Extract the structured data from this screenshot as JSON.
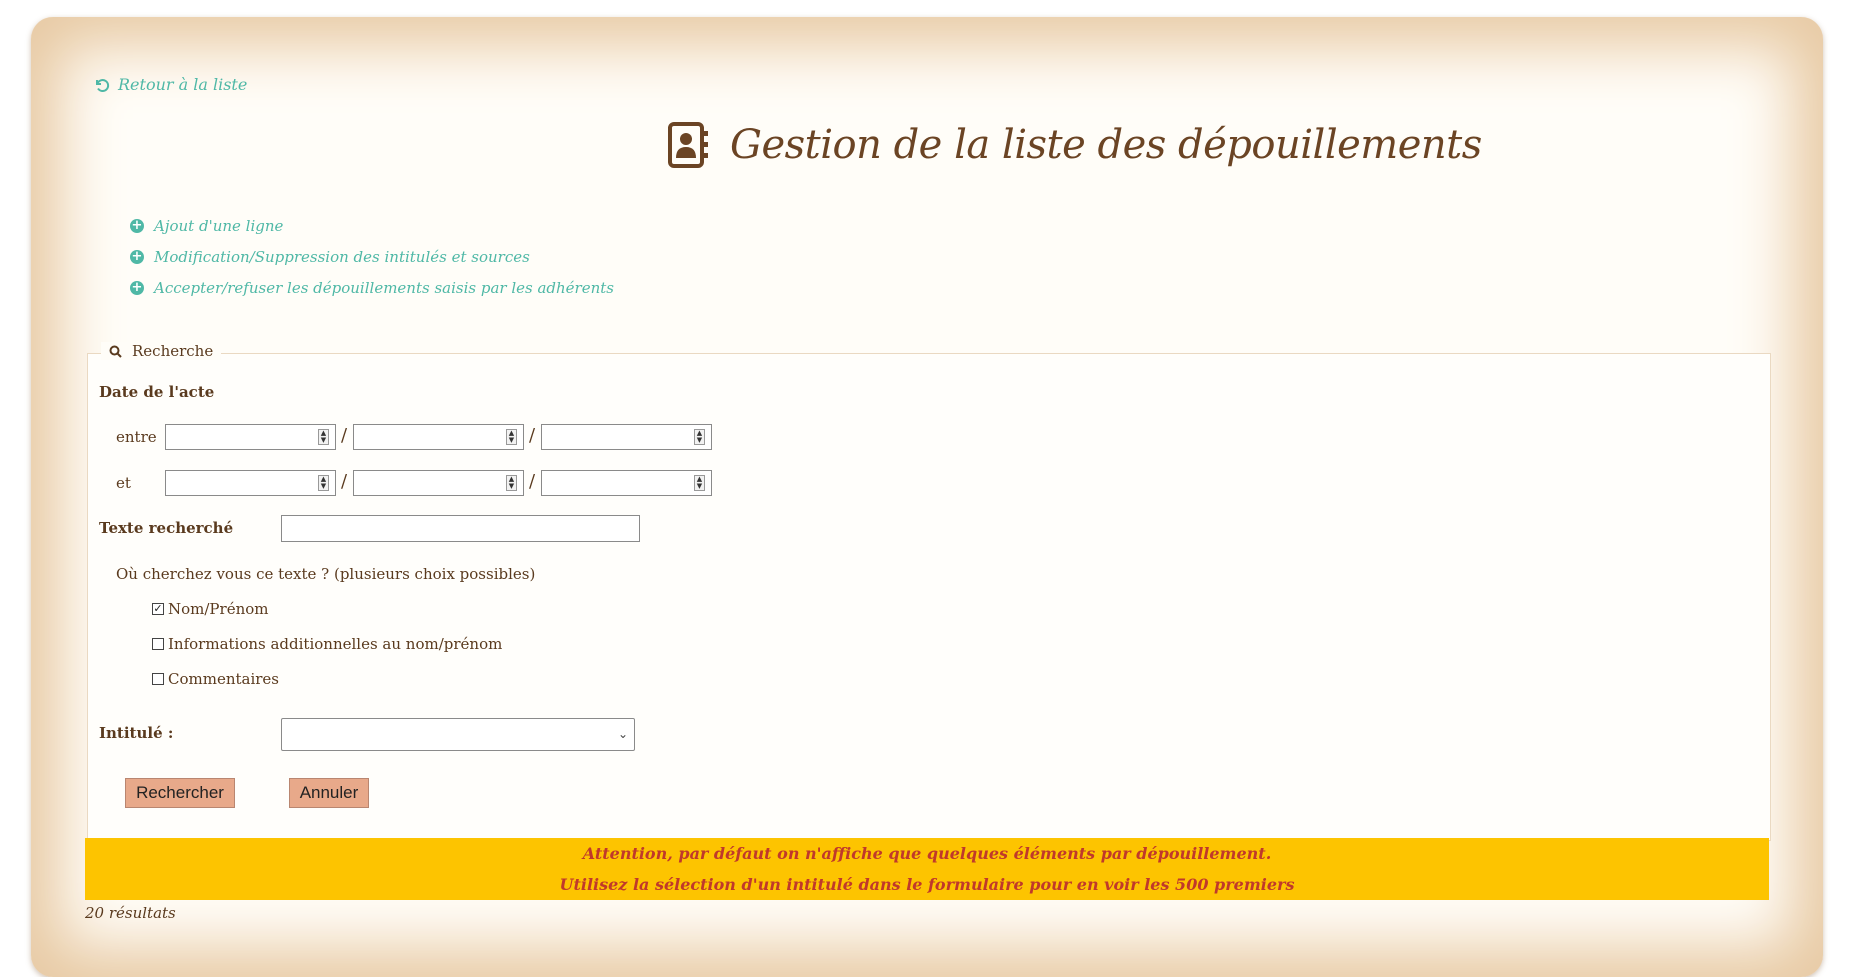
{
  "nav": {
    "back_label": "Retour à la liste"
  },
  "page": {
    "title": "Gestion de la liste des dépouillements"
  },
  "actions": [
    {
      "label": "Ajout d'une ligne"
    },
    {
      "label": "Modification/Suppression des intitulés et sources"
    },
    {
      "label": "Accepter/refuser les dépouillements saisis par les adhérents"
    }
  ],
  "search": {
    "legend": "Recherche",
    "date_label": "Date de l'acte",
    "between_label": "entre",
    "and_label": "et",
    "separator": "/",
    "text_label": "Texte recherché",
    "text_value": "",
    "where_label": "Où cherchez vous ce texte ? (plusieurs choix possibles)",
    "options": [
      {
        "label": "Nom/Prénom",
        "checked": true
      },
      {
        "label": "Informations additionnelles au nom/prénom",
        "checked": false
      },
      {
        "label": "Commentaires",
        "checked": false
      }
    ],
    "intitule_label": "Intitulé :",
    "intitule_value": "",
    "search_button": "Rechercher",
    "cancel_button": "Annuler"
  },
  "warning": {
    "line1": "Attention, par défaut on n'affiche que quelques éléments par dépouillement.",
    "line2": "Utilisez la sélection d'un intitulé dans le formulaire pour en voir les 500 premiers"
  },
  "results": {
    "count_label": "20 résultats"
  },
  "colors": {
    "accent": "#4fb8a6",
    "brown": "#6b4424",
    "warning_bg": "#fdc400",
    "warning_text": "#c0392b",
    "button": "#e8a98a"
  }
}
